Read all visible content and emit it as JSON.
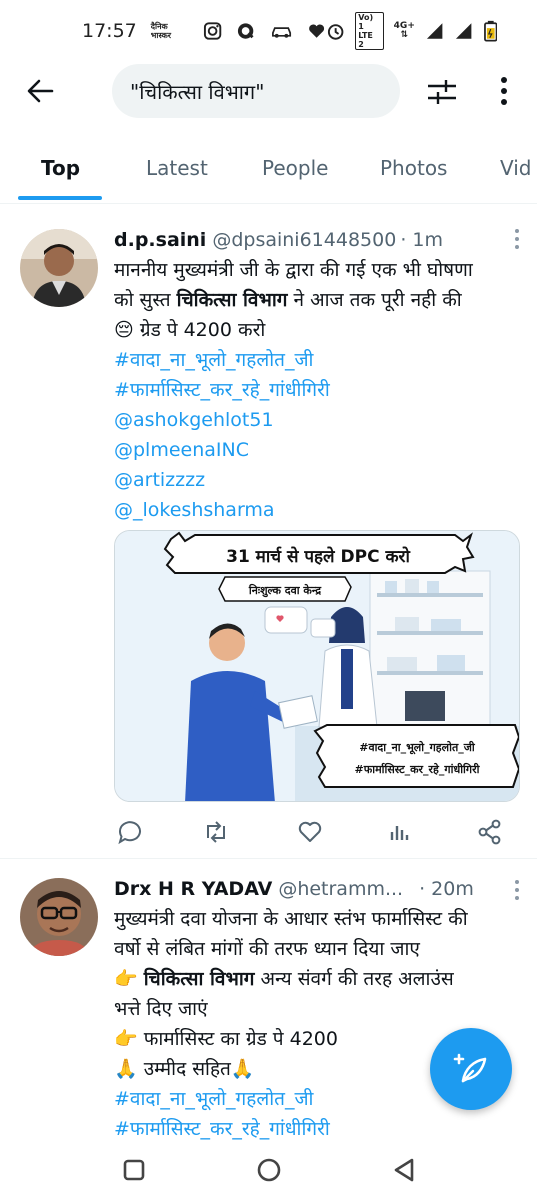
{
  "status_bar": {
    "time": "17:57",
    "network_label": "4G+",
    "lte_label_top": "Vo) 1",
    "lte_label_bottom": "LTE 2",
    "app_icon_label": "दैनिक भास्कर"
  },
  "search": {
    "query": "\"चिकित्सा विभाग\""
  },
  "tabs": [
    {
      "label": "Top",
      "active": true
    },
    {
      "label": "Latest",
      "active": false
    },
    {
      "label": "People",
      "active": false
    },
    {
      "label": "Photos",
      "active": false
    },
    {
      "label": "Vid",
      "active": false
    }
  ],
  "tweets": [
    {
      "name": "d.p.saini",
      "handle": "@dpsaini61448500",
      "time": "· 1m",
      "text_lines": [
        {
          "pre": "माननीय मुख्यमंत्री जी के द्वारा की गई एक भी घोषणा",
          "bold": "",
          "post": ""
        },
        {
          "pre": "को सुस्त ",
          "bold": "चिकित्सा विभाग",
          "post": " ने आज तक पूरी नही की"
        },
        {
          "pre": "😔 ग्रेड पे 4200 करो",
          "bold": "",
          "post": ""
        }
      ],
      "links": [
        "#वादा_ना_भूलो_गहलोत_जी",
        "#फार्मासिस्ट_कर_रहे_गांधीगिरी",
        "@ashokgehlot51",
        "@plmeenaINC",
        "@artizzzz",
        "@_lokeshsharma"
      ],
      "media": {
        "banner": "31 मार्च से पहले DPC करो",
        "shop_sign": "निःशुल्क दवा केन्द्र",
        "tag_1": "#वादा_ना_भूलो_गहलोत_जी",
        "tag_2": "#फार्मासिस्ट_कर_रहे_गांधीगिरी"
      }
    },
    {
      "name": "Drx H R YADAV",
      "handle": "@hetramm...",
      "time": "· 20m",
      "text_lines": [
        {
          "pre": "मुख्यमंत्री दवा योजना के आधार स्तंभ फार्मासिस्ट की",
          "bold": "",
          "post": ""
        },
        {
          "pre": "वर्षो से लंबित मांगों की तरफ ध्यान दिया जाए",
          "bold": "",
          "post": ""
        },
        {
          "pre": "👉 ",
          "bold": "चिकित्सा विभाग",
          "post": " अन्य संवर्ग की तरह अलाउंस"
        },
        {
          "pre": "भत्ते दिए जाएं",
          "bold": "",
          "post": ""
        },
        {
          "pre": "👉 फार्मासिस्ट का ग्रेड पे 4200",
          "bold": "",
          "post": ""
        },
        {
          "pre": "🙏  उम्मीद सहित🙏",
          "bold": "",
          "post": ""
        }
      ],
      "links": [
        "#वादा_ना_भूलो_गहलोत_जी",
        "#फार्मासिस्ट_कर_रहे_गांधीगिरी"
      ]
    }
  ],
  "colors": {
    "accent": "#1d9bf0",
    "text": "#0f1419",
    "secondary": "#536471"
  }
}
